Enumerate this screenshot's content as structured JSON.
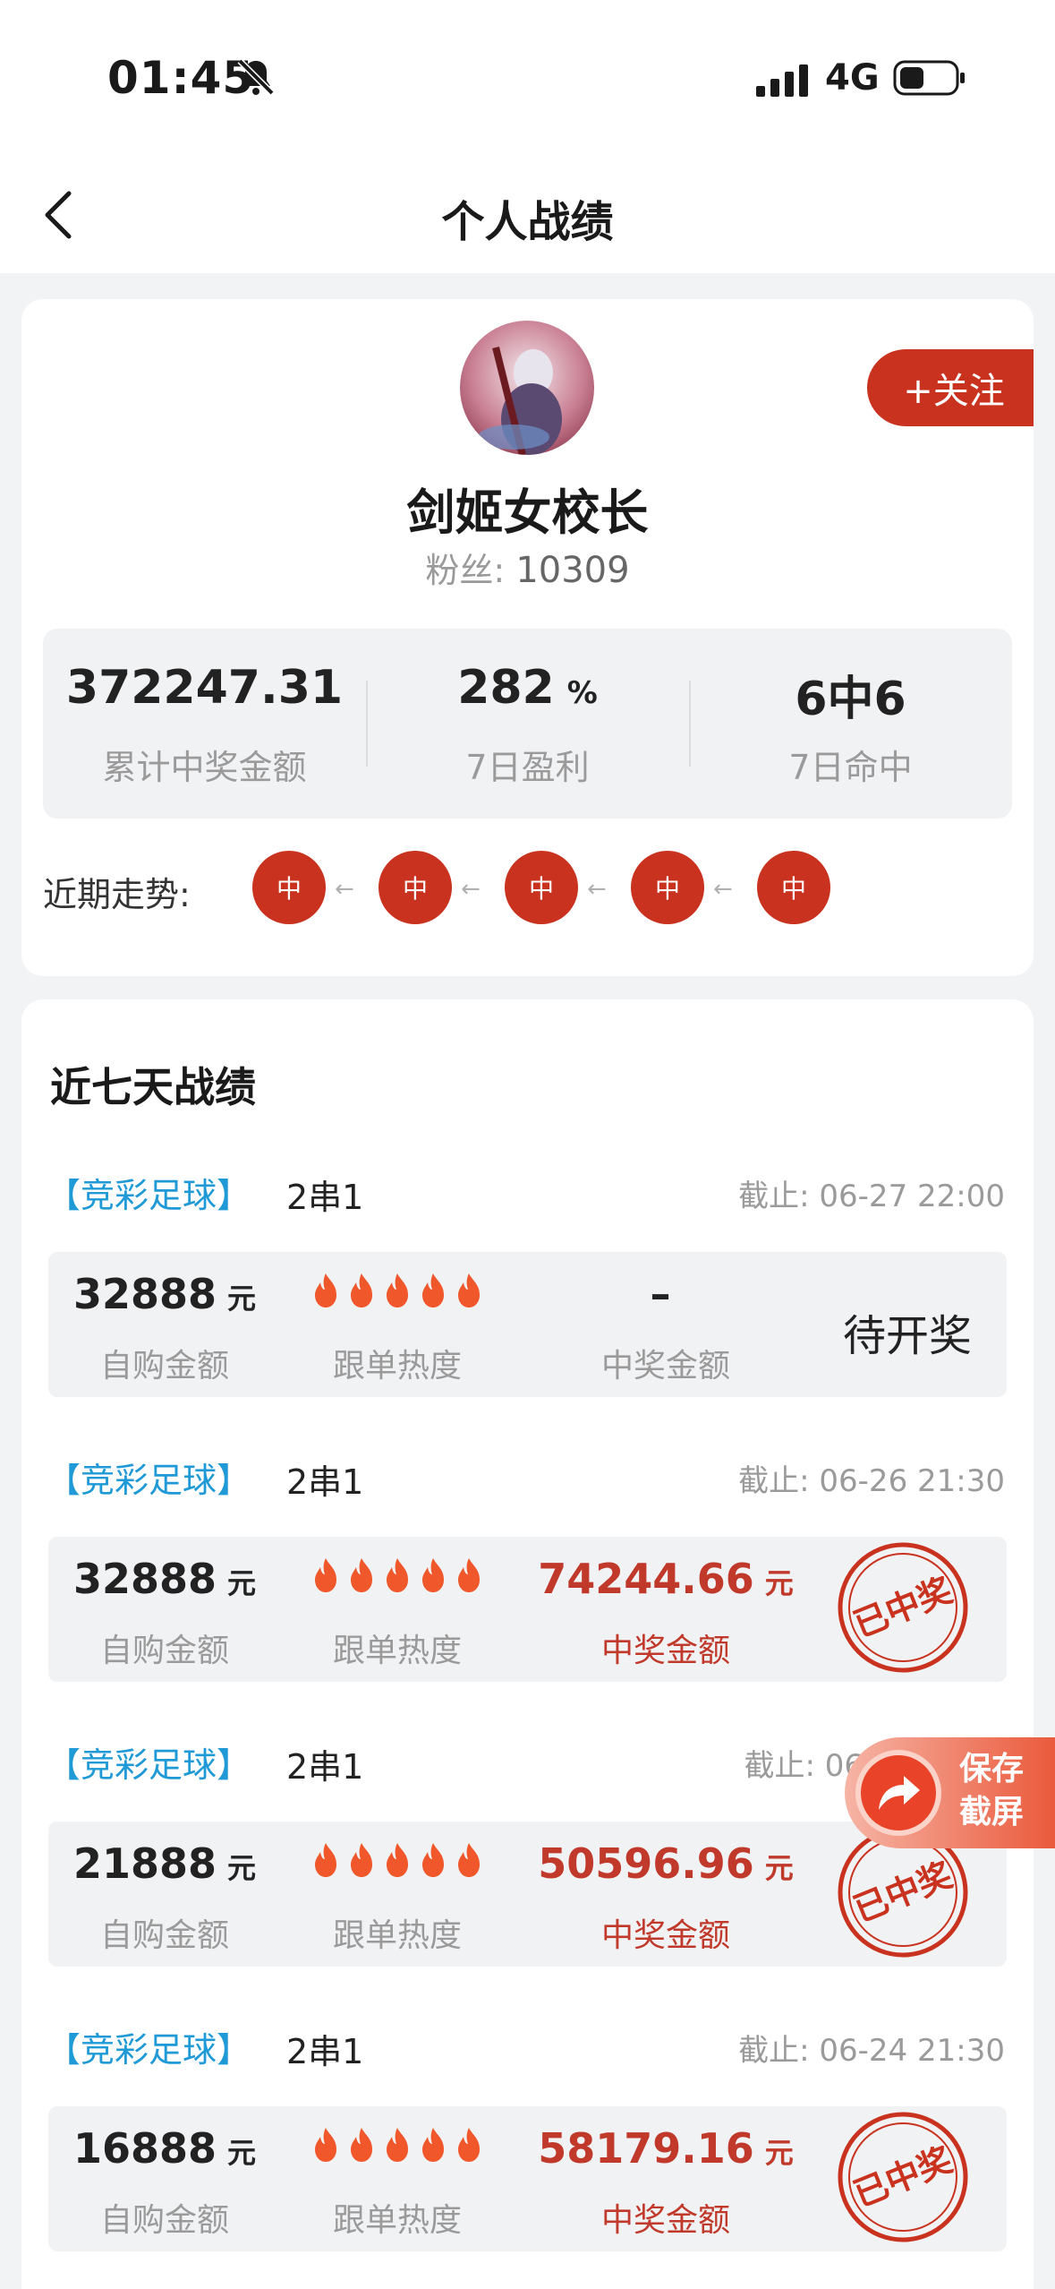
{
  "status_bar": {
    "time": "01:45",
    "network": "4G"
  },
  "nav": {
    "title": "个人战绩"
  },
  "profile": {
    "name": "剑姬女校长",
    "fans_label": "粉丝:",
    "fans_count": "10309",
    "follow_label": "+关注"
  },
  "stats": [
    {
      "value": "372247.31",
      "unit": "",
      "label": "累计中奖金额"
    },
    {
      "value": "282",
      "unit": "%",
      "label": "7日盈利"
    },
    {
      "value": "6中6",
      "unit": "",
      "label": "7日命中"
    }
  ],
  "trend": {
    "label": "近期走势:",
    "items": [
      "中",
      "中",
      "中",
      "中",
      "中"
    ],
    "arrow": "←"
  },
  "records_title": "近七天战绩",
  "records": [
    {
      "tag": "【竞彩足球】",
      "type": "2串1",
      "deadline": "截止: 06-27 22:00",
      "amount": "32888",
      "amount_unit": "元",
      "amount_label": "自购金额",
      "heat_label": "跟单热度",
      "heat_level": 5,
      "prize": "–",
      "prize_unit": "",
      "prize_label": "中奖金额",
      "status": "待开奖",
      "won": false
    },
    {
      "tag": "【竞彩足球】",
      "type": "2串1",
      "deadline": "截止: 06-26 21:30",
      "amount": "32888",
      "amount_unit": "元",
      "amount_label": "自购金额",
      "heat_label": "跟单热度",
      "heat_level": 5,
      "prize": "74244.66",
      "prize_unit": "元",
      "prize_label": "中奖金额",
      "status": "已中奖",
      "won": true
    },
    {
      "tag": "【竞彩足球】",
      "type": "2串1",
      "deadline": "截止: 06",
      "amount": "21888",
      "amount_unit": "元",
      "amount_label": "自购金额",
      "heat_label": "跟单热度",
      "heat_level": 5,
      "prize": "50596.96",
      "prize_unit": "元",
      "prize_label": "中奖金额",
      "status": "已中奖",
      "won": true
    },
    {
      "tag": "【竞彩足球】",
      "type": "2串1",
      "deadline": "截止: 06-24 21:30",
      "amount": "16888",
      "amount_unit": "元",
      "amount_label": "自购金额",
      "heat_label": "跟单热度",
      "heat_level": 5,
      "prize": "58179.16",
      "prize_unit": "元",
      "prize_label": "中奖金额",
      "status": "已中奖",
      "won": true
    }
  ],
  "save_float": {
    "line1": "保存",
    "line2": "截屏"
  },
  "colors": {
    "accent_red": "#c9321e",
    "tag_blue": "#1f9ad6",
    "flame_orange": "#f0572b"
  },
  "icons": [
    "bell-slash-icon",
    "signal-icon",
    "battery-icon",
    "back-arrow-icon",
    "flame-icon",
    "won-stamp-icon",
    "share-arrow-icon"
  ]
}
